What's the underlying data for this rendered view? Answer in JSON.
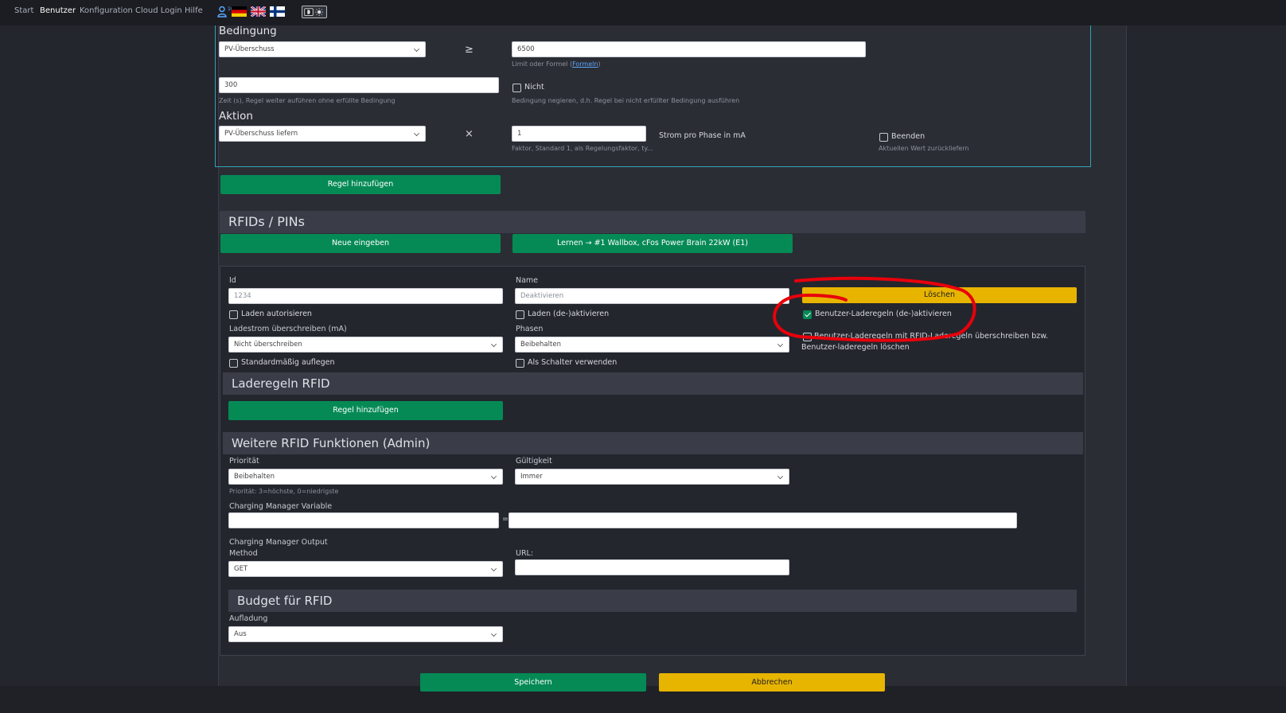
{
  "nav": {
    "items": [
      "Start",
      "Benutzer",
      "Konfiguration",
      "Cloud Login",
      "Hilfe"
    ],
    "active": "Benutzer",
    "user_badge": "10",
    "flags": [
      "german-flag-icon",
      "uk-flag-icon",
      "finnish-flag-icon"
    ],
    "theme_toggle": "dark-light-toggle-icon"
  },
  "rule": {
    "condition_heading": "Bedingung",
    "condition_select": "PV-Überschuss",
    "operator": "≥",
    "limit_value": "6500",
    "limit_hint_prefix": "Limit oder Formel (",
    "limit_hint_link": "Formeln",
    "limit_hint_suffix": ")",
    "time_value": "300",
    "time_hint": "Zeit (s), Regel weiter auführen ohne erfüllte Bedingung",
    "not_label": "Nicht",
    "not_hint": "Bedingung negieren, d.h. Regel bei nicht erfüllter Bedingung ausführen",
    "action_heading": "Aktion",
    "action_select": "PV-Überschuss liefern",
    "action_operator": "×",
    "factor_value": "1",
    "factor_hint": "Faktor, Standard 1, als Regelungsfaktor, ty...",
    "unit_label": "Strom pro Phase in mA",
    "end_label": "Beenden",
    "end_hint": "Aktuellen Wert zurückliefern"
  },
  "add_rule_button": "Regel hinzufügen",
  "rfid": {
    "heading": "RFIDs / PINs",
    "new_button": "Neue eingeben",
    "learn_button": "Lernen → #1 Wallbox, cFos Power Brain 22kW (E1)",
    "id_label": "Id",
    "id_placeholder": "1234",
    "name_label": "Name",
    "name_placeholder": "Deaktivieren",
    "delete_button": "Löschen",
    "authorize_label": "Laden autorisieren",
    "toggle_charging_label": "Laden (de-)aktivieren",
    "user_rules_label": "Benutzer-Laderegeln (de-)aktivieren",
    "override_label": "Benutzer-Laderegeln mit RFID-Laderegeln überschreiben bzw. Benutzer-laderegeln löschen",
    "current_label": "Ladestrom überschreiben (mA)",
    "current_select": "Nicht überschreiben",
    "phases_label": "Phasen",
    "phases_select": "Beibehalten",
    "default_label": "Standardmäßig auflegen",
    "switch_label": "Als Schalter verwenden",
    "rules_heading": "Laderegeln RFID",
    "rules_add_button": "Regel hinzufügen",
    "admin_heading": "Weitere RFID Funktionen (Admin)",
    "priority_label": "Priorität",
    "priority_select": "Beibehalten",
    "priority_hint": "Priorität: 3=höchste, 0=niedrigste",
    "validity_label": "Gültigkeit",
    "validity_select": "Immer",
    "cm_variable_label": "Charging Manager Variable",
    "equals": "=",
    "cm_output_label": "Charging Manager Output",
    "method_label": "Method",
    "method_select": "GET",
    "url_label": "URL:",
    "budget_heading": "Budget für RFID",
    "charge_label": "Aufladung",
    "charge_select": "Aus"
  },
  "footer": {
    "save_button": "Speichern",
    "cancel_button": "Abbrechen"
  },
  "colors": {
    "accent_green": "#058a56",
    "accent_yellow": "#e7b400",
    "annotation_red": "#e8000b",
    "rule_border": "#2fa3b8"
  }
}
